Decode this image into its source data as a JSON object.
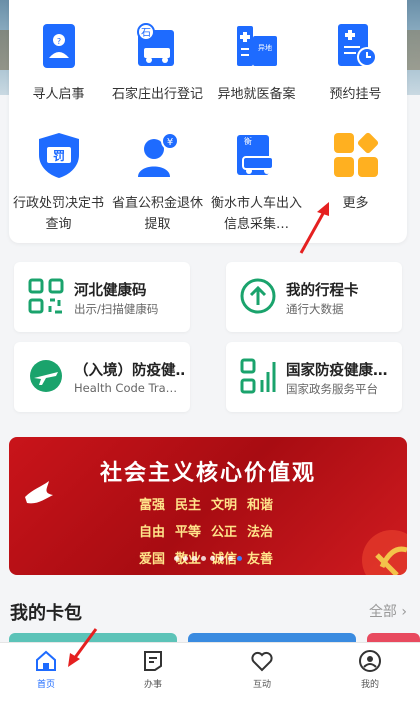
{
  "services": [
    {
      "label": "寻人启事",
      "icon": "person-search-icon"
    },
    {
      "label": "石家庄出行登记",
      "icon": "car-registration-icon"
    },
    {
      "label": "异地就医备案",
      "icon": "hospital-icon"
    },
    {
      "label": "预约挂号",
      "icon": "appointment-icon"
    },
    {
      "label": "行政处罚决定书查询",
      "icon": "penalty-shield-icon"
    },
    {
      "label": "省直公积金退休提取",
      "icon": "fund-withdraw-icon"
    },
    {
      "label": "衡水市人车出入信息采集…",
      "icon": "vehicle-record-icon"
    },
    {
      "label": "更多",
      "icon": "more-grid-icon"
    }
  ],
  "quick": [
    {
      "title": "河北健康码",
      "subtitle": "出示/扫描健康码",
      "icon": "qr-code-icon"
    },
    {
      "title": "我的行程卡",
      "subtitle": "通行大数据",
      "icon": "arrow-up-circle-icon"
    },
    {
      "title": "（入境）防疫健…",
      "subtitle": "Health Code Tra…",
      "icon": "airplane-icon"
    },
    {
      "title": "国家防疫健康…",
      "subtitle": "国家政务服务平台",
      "icon": "stats-icon"
    }
  ],
  "banner": {
    "title": "社会主义核心价值观",
    "values": [
      "富强",
      "民主",
      "文明",
      "和谐",
      "自由",
      "平等",
      "公正",
      "法治",
      "爱国",
      "敬业",
      "诚信",
      "友善"
    ],
    "dot_count": 8,
    "active_dot": 7
  },
  "wallet": {
    "title": "我的卡包",
    "more": "全部"
  },
  "tabs": [
    {
      "label": "首页",
      "icon": "home-icon",
      "active": true
    },
    {
      "label": "办事",
      "icon": "document-icon",
      "active": false
    },
    {
      "label": "互动",
      "icon": "heart-icon",
      "active": false
    },
    {
      "label": "我的",
      "icon": "user-icon",
      "active": false
    }
  ],
  "colors": {
    "primary": "#1e6bff",
    "accent_orange": "#ffb020",
    "green": "#1aa36c",
    "banner_red": "#c9141a"
  }
}
